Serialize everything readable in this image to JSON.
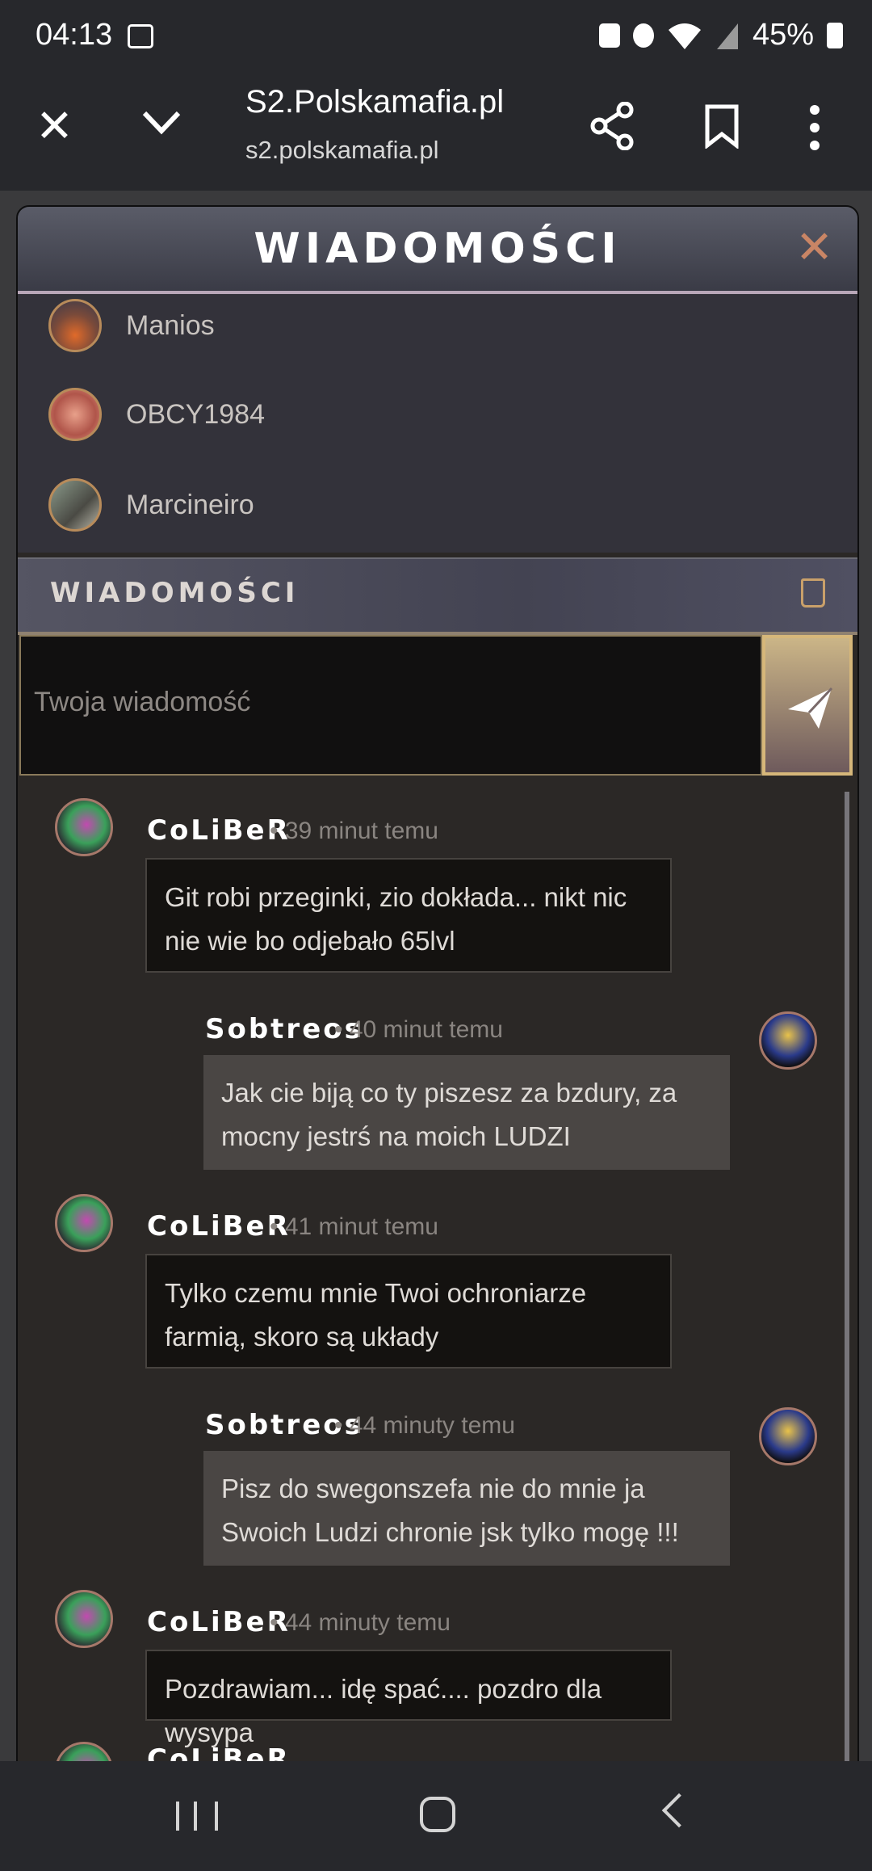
{
  "status_bar": {
    "time": "04:13",
    "battery": "45%"
  },
  "browser": {
    "title": "S2.Polskamafia.pl",
    "url": "s2.polskamafia.pl"
  },
  "panel": {
    "title": "WIADOMOŚCI",
    "contacts": [
      {
        "name": "Manios"
      },
      {
        "name": "OBCY1984"
      },
      {
        "name": "Marcineiro"
      }
    ],
    "messages_header": "WIADOMOŚCI",
    "compose_placeholder": "Twoja wiadomość"
  },
  "messages": [
    {
      "author": "CoLiBeR",
      "time": "• 39 minut temu",
      "text": "Git robi przeginki, zio dokłada... nikt nic nie wie bo odjebało 65lvl"
    },
    {
      "author": "Sobtreos",
      "time": "• 40 minut temu",
      "text": "Jak cie biją co ty piszesz za bzdury, za mocny jestrś na moich LUDZI"
    },
    {
      "author": "CoLiBeR",
      "time": "• 41 minut temu",
      "text": "Tylko czemu mnie Twoi ochroniarze farmią, skoro są układy"
    },
    {
      "author": "Sobtreos",
      "time": "• 44 minuty temu",
      "text": "Pisz do swegonszefa nie do mnie ja Swoich Ludzi chronie jsk tylko mogę !!!"
    },
    {
      "author": "CoLiBeR",
      "time": "• 44 minuty temu",
      "text": "Pozdrawiam... idę spać.... pozdro dla wysypa"
    },
    {
      "author": "CoLiBeR",
      "time": "",
      "text": ""
    }
  ],
  "colors": {
    "accent_gold": "#d6b77a",
    "panel_bg": "#2b2826",
    "header_bg": "#4a4b58"
  }
}
